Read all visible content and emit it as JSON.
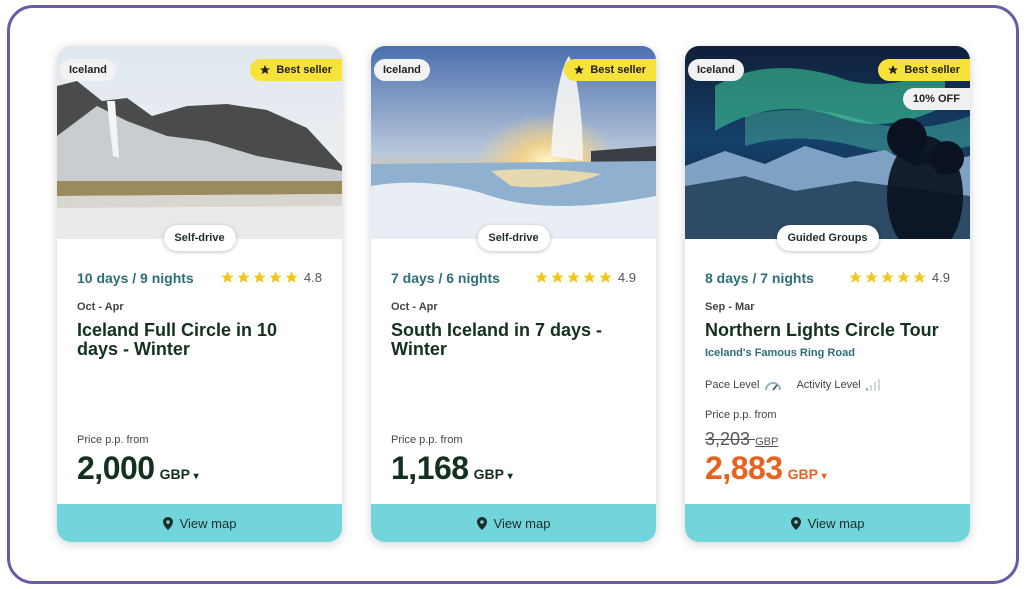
{
  "cards": [
    {
      "country": "Iceland",
      "badge": "Best seller",
      "tour_type": "Self-drive",
      "duration": "10 days / 9 nights",
      "rating": "4.8",
      "rating_stars": 5,
      "season": "Oct - Apr",
      "title": "Iceland Full Circle in 10 days - Winter",
      "price_label": "Price p.p. from",
      "price": "2,000",
      "currency": "GBP",
      "map_label": "View map"
    },
    {
      "country": "Iceland",
      "badge": "Best seller",
      "tour_type": "Self-drive",
      "duration": "7 days / 6 nights",
      "rating": "4.9",
      "rating_stars": 5,
      "season": "Oct - Apr",
      "title": "South Iceland in 7 days - Winter",
      "price_label": "Price p.p. from",
      "price": "1,168",
      "currency": "GBP",
      "map_label": "View map"
    },
    {
      "country": "Iceland",
      "badge": "Best seller",
      "discount": "10% OFF",
      "tour_type": "Guided Groups",
      "duration": "8 days / 7 nights",
      "rating": "4.9",
      "rating_stars": 5,
      "season": "Sep - Mar",
      "title": "Northern Lights Circle Tour",
      "subtitle": "Iceland's Famous Ring Road",
      "pace_label": "Pace Level",
      "activity_label": "Activity Level",
      "price_label": "Price p.p. from",
      "old_price": "3,203",
      "price": "2,883",
      "currency": "GBP",
      "map_label": "View map"
    }
  ],
  "colors": {
    "frame": "#6a5aa6",
    "badge": "#f7e23a",
    "map_bar": "#72d5dc",
    "duration": "#2c6e7a",
    "sale_price": "#e8611f",
    "star": "#f5c518"
  },
  "icons": {
    "badge": "star-icon",
    "map": "map-pin-icon",
    "price_dropdown": "chevron-down-icon",
    "pace": "gauge-icon",
    "activity": "signal-bars-icon"
  }
}
